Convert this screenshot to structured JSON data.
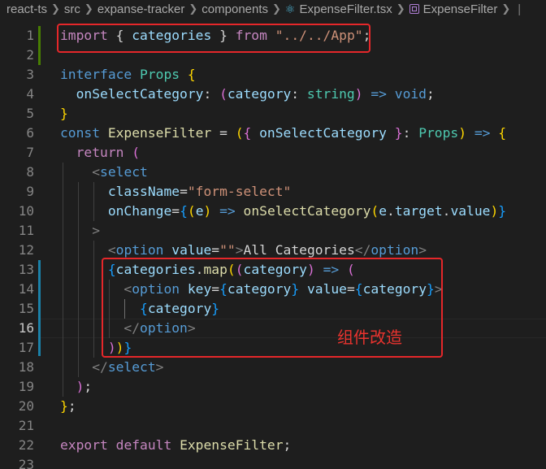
{
  "breadcrumb": {
    "parts": [
      "react-ts",
      "src",
      "expanse-tracker",
      "components",
      "ExpenseFilter.tsx",
      "ExpenseFilter"
    ],
    "tail": "|"
  },
  "gutter": {
    "line_numbers": [
      "1",
      "2",
      "3",
      "4",
      "5",
      "6",
      "7",
      "8",
      "9",
      "10",
      "11",
      "12",
      "13",
      "14",
      "15",
      "16",
      "17",
      "18",
      "19",
      "20",
      "21",
      "22",
      "23"
    ],
    "active_line": "16"
  },
  "code": {
    "l1": {
      "t1": "import",
      "t2": " { ",
      "t3": "categories",
      "t4": " } ",
      "t5": "from",
      "t6": " ",
      "t7": "\"../../App\"",
      "t8": ";"
    },
    "l3": {
      "t1": "interface",
      "t2": " ",
      "t3": "Props",
      "t4": " {"
    },
    "l4": {
      "t1": "  ",
      "t2": "onSelectCategory",
      "t3": ": ",
      "t4": "(",
      "t5": "category",
      "t6": ": ",
      "t7": "string",
      "t8": ")",
      "t9": " => ",
      "t10": "void",
      "t11": ";"
    },
    "l5": {
      "t1": "}"
    },
    "l6": {
      "t1": "const",
      "t2": " ",
      "t3": "ExpenseFilter",
      "t4": " = ",
      "t5": "(",
      "t6": "{",
      "t7": " ",
      "t8": "onSelectCategory",
      "t9": " ",
      "t10": "}",
      "t11": ": ",
      "t12": "Props",
      "t13": ")",
      "t14": " => ",
      "t15": "{"
    },
    "l7": {
      "t1": "  ",
      "t2": "return",
      "t3": " ",
      "t4": "("
    },
    "l8": {
      "t1": "    ",
      "t2": "<",
      "t3": "select"
    },
    "l9": {
      "t1": "      ",
      "t2": "className",
      "t3": "=",
      "t4": "\"form-select\""
    },
    "l10": {
      "t1": "      ",
      "t2": "onChange",
      "t3": "=",
      "t4": "{",
      "t5": "(",
      "t6": "e",
      "t7": ")",
      "t8": " => ",
      "t9": "onSelectCategory",
      "t10": "(",
      "t11": "e",
      "t12": ".",
      "t13": "target",
      "t14": ".",
      "t15": "value",
      "t16": ")",
      "t17": "}"
    },
    "l11": {
      "t1": "    ",
      "t2": ">"
    },
    "l12": {
      "t1": "      ",
      "t2": "<",
      "t3": "option",
      "t4": " ",
      "t5": "value",
      "t6": "=",
      "t7": "\"\"",
      "t8": ">",
      "t9": "All Categories",
      "t10": "</",
      "t11": "option",
      "t12": ">"
    },
    "l13": {
      "t1": "      ",
      "t2": "{",
      "t3": "categories",
      "t4": ".",
      "t5": "map",
      "t6": "(",
      "t7": "(",
      "t8": "category",
      "t9": ")",
      "t10": " => ",
      "t11": "("
    },
    "l14": {
      "t1": "        ",
      "t2": "<",
      "t3": "option",
      "t4": " ",
      "t5": "key",
      "t6": "=",
      "t7": "{",
      "t8": "category",
      "t9": "}",
      "t10": " ",
      "t11": "value",
      "t12": "=",
      "t13": "{",
      "t14": "category",
      "t15": "}",
      "t16": ">"
    },
    "l15": {
      "t1": "          ",
      "t2": "{",
      "t3": "category",
      "t4": "}"
    },
    "l16": {
      "t1": "        ",
      "t2": "</",
      "t3": "option",
      "t4": ">"
    },
    "l17": {
      "t1": "      ",
      "t2": ")",
      "t3": ")",
      "t4": "}"
    },
    "l18": {
      "t1": "    ",
      "t2": "</",
      "t3": "select",
      "t4": ">"
    },
    "l19": {
      "t1": "  ",
      "t2": ")",
      "t3": ";"
    },
    "l20": {
      "t1": "}",
      "t2": ";"
    },
    "l22": {
      "t1": "export",
      "t2": " ",
      "t3": "default",
      "t4": " ",
      "t5": "ExpenseFilter",
      "t6": ";"
    }
  },
  "annotation": {
    "text": "组件改造"
  },
  "colors": {
    "background": "#1e1e1e",
    "highlight_box": "#e5272a",
    "annotation": "#e8332e"
  }
}
